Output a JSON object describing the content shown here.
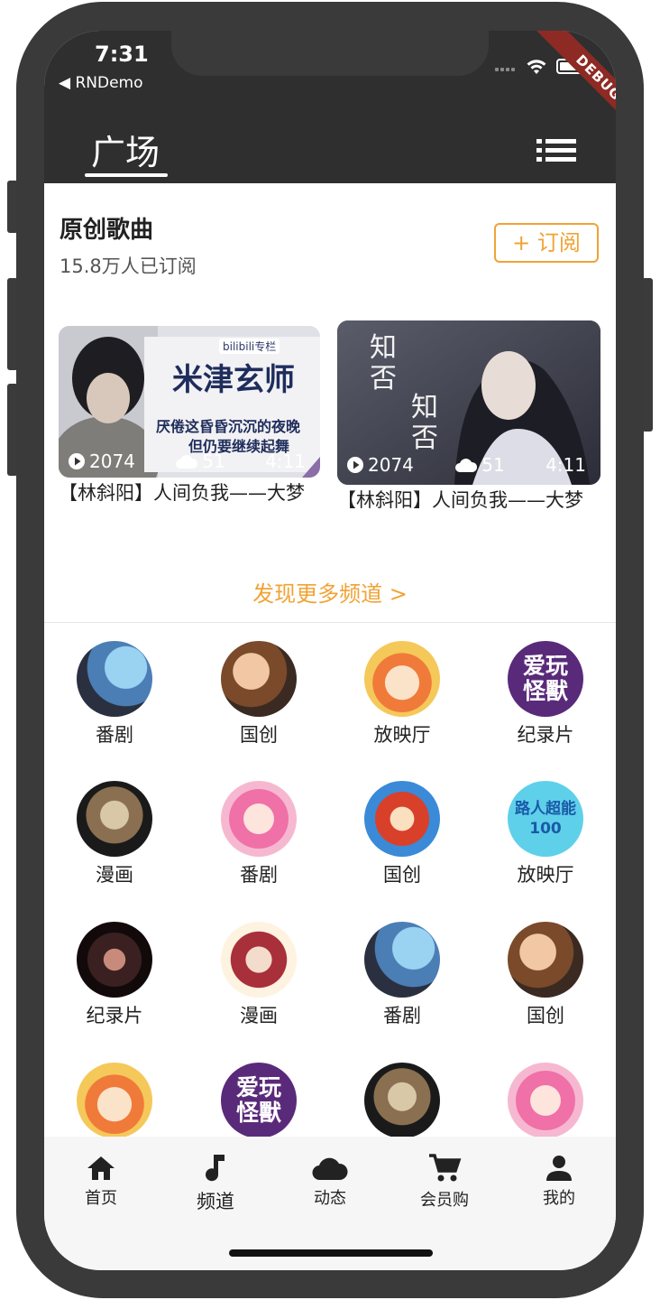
{
  "status_bar": {
    "time": "7:31",
    "back_app": "◀ RNDemo",
    "debug_banner": "DEBUG"
  },
  "header": {
    "active_tab": "广场",
    "menu_icon": "list-menu-icon"
  },
  "channel": {
    "title": "原创歌曲",
    "subscribers": "15.8万人已订阅",
    "subscribe_label": "+ 订阅"
  },
  "videos": [
    {
      "thumb_texts": {
        "brand": "bilibili专栏",
        "heading": "米津玄师",
        "line1": "厌倦这昏昏沉沉的夜晚",
        "line2": "但仍要继续起舞"
      },
      "plays": "2074",
      "comments": "51",
      "duration": "4:11",
      "title": "【林斜阳】人间负我——大梦"
    },
    {
      "thumb_texts": {
        "calligraphy_a": "知否",
        "calligraphy_b": "知否"
      },
      "plays": "2074",
      "comments": "51",
      "duration": "4:11",
      "title": "【林斜阳】人间负我——大梦"
    }
  ],
  "discover_more": "发现更多频道 >",
  "grid": [
    {
      "label": "番剧",
      "badge": ""
    },
    {
      "label": "国创",
      "badge": ""
    },
    {
      "label": "放映厅",
      "badge": ""
    },
    {
      "label": "纪录片",
      "badge": "爱玩怪獸"
    },
    {
      "label": "漫画",
      "badge": ""
    },
    {
      "label": "番剧",
      "badge": ""
    },
    {
      "label": "国创",
      "badge": ""
    },
    {
      "label": "放映厅",
      "badge": "路人超能100"
    },
    {
      "label": "纪录片",
      "badge": ""
    },
    {
      "label": "漫画",
      "badge": ""
    },
    {
      "label": "番剧",
      "badge": ""
    },
    {
      "label": "国创",
      "badge": ""
    },
    {
      "label": "",
      "badge": ""
    },
    {
      "label": "",
      "badge": "爱玩怪獸"
    },
    {
      "label": "",
      "badge": ""
    },
    {
      "label": "",
      "badge": ""
    }
  ],
  "bottom_nav": [
    {
      "label": "首页",
      "icon": "home-icon"
    },
    {
      "label": "频道",
      "icon": "music-note-icon"
    },
    {
      "label": "动态",
      "icon": "cloud-icon"
    },
    {
      "label": "会员购",
      "icon": "cart-icon"
    },
    {
      "label": "我的",
      "icon": "person-icon"
    }
  ],
  "colors": {
    "accent": "#f0a335",
    "header_bg": "#2f2f2f",
    "frame": "#3a3a3a"
  }
}
